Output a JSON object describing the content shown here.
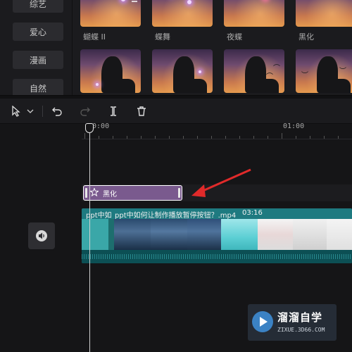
{
  "categories": [
    "综艺",
    "爱心",
    "漫画",
    "自然"
  ],
  "effects_row1": [
    "蝴蝶 II",
    "蝶舞",
    "夜蝶",
    "黑化"
  ],
  "toolbar": {
    "select_icon": "cursor-arrow-icon",
    "dropdown_icon": "chevron-down-icon",
    "undo_icon": "undo-icon",
    "redo_icon": "redo-icon",
    "split_icon": "split-icon",
    "delete_icon": "trash-icon"
  },
  "ruler": {
    "start_label": "00:00",
    "mark_label": "01:00"
  },
  "effect_clip": {
    "label": "黑化",
    "icon": "sparkle-star-icon",
    "color": "#7a5a8e"
  },
  "video_clip": {
    "short_title": "ppt中如",
    "title": "ppt中如何让制作播放暂停按钮？.mp4",
    "duration": "03:16",
    "color": "#0f5f64"
  },
  "volume_icon": "speaker-icon",
  "annotation": {
    "color": "#e02a2a"
  },
  "watermark": {
    "title": "溜溜自学",
    "subtitle": "ZIXUE.3D66.COM"
  }
}
